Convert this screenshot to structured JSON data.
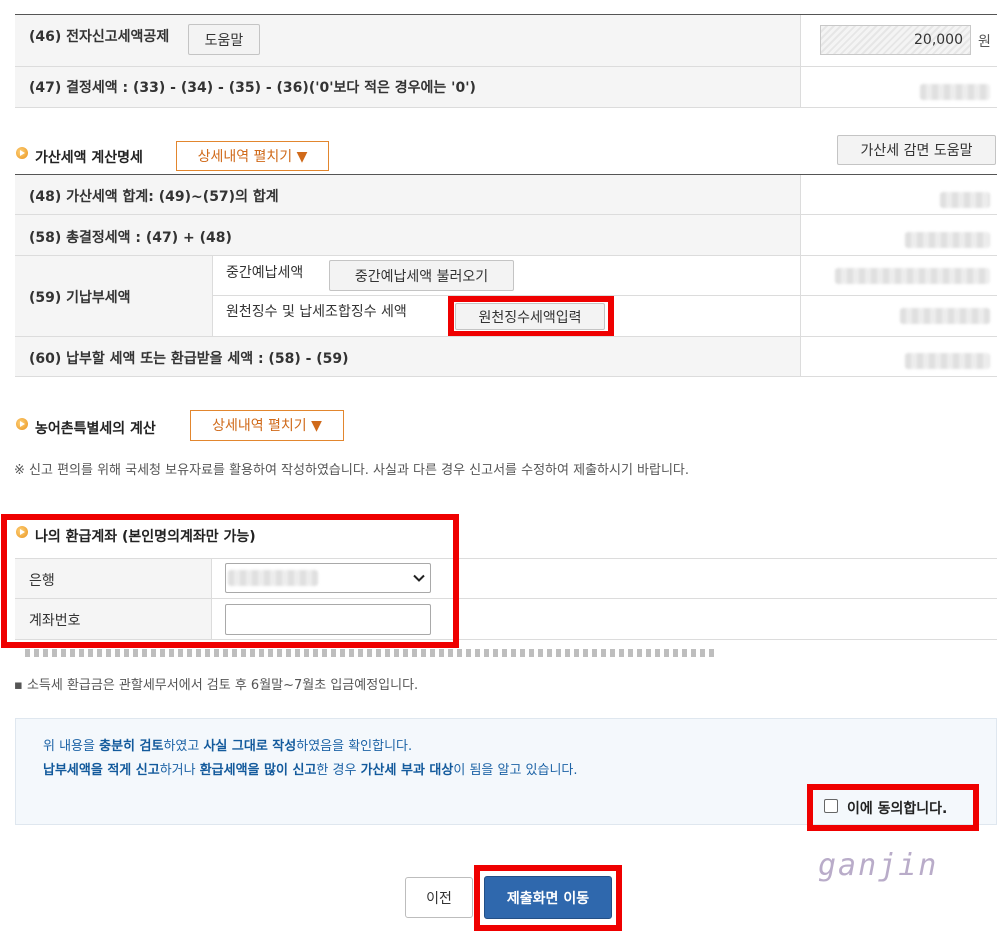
{
  "tax_rows": {
    "row46": {
      "label": "(46) 전자신고세액공제",
      "help_button": "도움말",
      "amount": "20,000",
      "unit": "원"
    },
    "row47": {
      "label": "(47) 결정세액 : (33) - (34) - (35) - (36)('0'보다 적은 경우에는 '0')"
    }
  },
  "penalty_section": {
    "title": "가산세액 계산명세",
    "expand_button": "상세내역 펼치기 ▼",
    "help_button": "가산세 감면 도움말",
    "rows": {
      "row48": "(48) 가산세액 합계: (49)~(57)의 합계",
      "row58": "(58) 총결정세액 : (47) + (48)",
      "row59": "(59) 기납부세액",
      "row59_interim_label": "중간예납세액",
      "row59_interim_button": "중간예납세액 불러오기",
      "row59_withholding_label": "원천징수 및 납세조합징수 세액",
      "row59_withholding_button": "원천징수세액입력",
      "row60": "(60) 납부할 세액 또는 환급받을 세액 : (58) - (59)"
    }
  },
  "rural_section": {
    "title": "농어촌특별세의 계산",
    "expand_button": "상세내역 펼치기 ▼"
  },
  "notice": "※ 신고 편의를 위해 국세청 보유자료를 활용하여 작성하였습니다. 사실과 다른 경우 신고서를 수정하여 제출하시기 바랍니다.",
  "refund_section": {
    "title": "나의 환급계좌 (본인명의계좌만 가능)",
    "bank_label": "은행",
    "account_label": "계좌번호",
    "account_value": "",
    "note1": "▪ 소득세 환급금은 관할세무서에서 검토 후 6월말~7월초 입금예정입니다."
  },
  "confirm_box": {
    "line1_parts": [
      "위 내용을 ",
      "충분히 검토",
      "하였고 ",
      "사실 그대로 작성",
      "하였음을 확인합니다."
    ],
    "line2_parts": [
      "납부세액을 적게 신고",
      "하거나 ",
      "환급세액을 많이 신고",
      "한 경우 ",
      "가산세 부과 대상",
      "이 됨을 알고 있습니다."
    ],
    "agree_label": "이에 동의합니다."
  },
  "watermark": "ganjin",
  "footer": {
    "prev_button": "이전",
    "submit_button": "제출화면 이동"
  },
  "colors": {
    "accent_orange": "#e2862e",
    "highlight_red": "#ef0000",
    "submit_blue": "#2f68ad",
    "emphasis_blue": "#135a9c"
  }
}
